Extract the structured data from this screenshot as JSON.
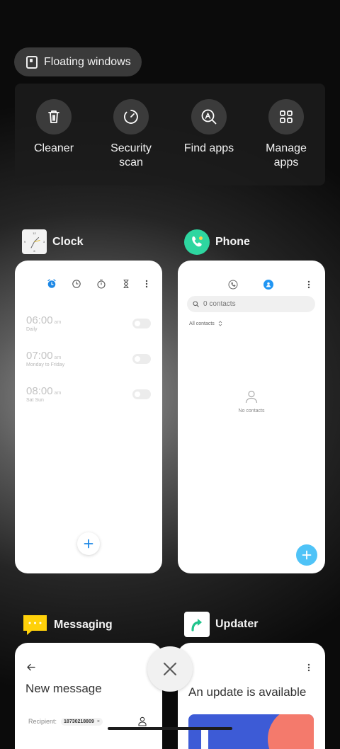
{
  "floating_windows": {
    "label": "Floating windows",
    "icon": "floating-window-icon"
  },
  "quick_actions": [
    {
      "label_lines": [
        "Cleaner"
      ],
      "icon": "trash-icon"
    },
    {
      "label_lines": [
        "Security",
        "scan"
      ],
      "icon": "security-scan-icon"
    },
    {
      "label_lines": [
        "Find apps"
      ],
      "icon": "find-apps-icon"
    },
    {
      "label_lines": [
        "Manage",
        "apps"
      ],
      "icon": "grid-icon"
    }
  ],
  "apps": {
    "clock": {
      "name": "Clock",
      "alarms": [
        {
          "time": "06:00",
          "suffix": "am",
          "days": "Daily",
          "enabled": false
        },
        {
          "time": "07:00",
          "suffix": "am",
          "days": "Monday to Friday",
          "enabled": false
        },
        {
          "time": "08:00",
          "suffix": "am",
          "days": "Sat Sun",
          "enabled": false
        }
      ],
      "accent": "#1e88e5"
    },
    "phone": {
      "name": "Phone",
      "search_placeholder": "0 contacts",
      "filter_label": "All contacts",
      "empty_label": "No contacts",
      "accent": "#2196f3",
      "fab_color": "#4fc3f7"
    },
    "messaging": {
      "name": "Messaging",
      "title": "New message",
      "recipient_label": "Recipient:",
      "recipient_value": "18730218809",
      "recipient_remove": "×"
    },
    "updater": {
      "name": "Updater",
      "title": "An update is available"
    }
  }
}
